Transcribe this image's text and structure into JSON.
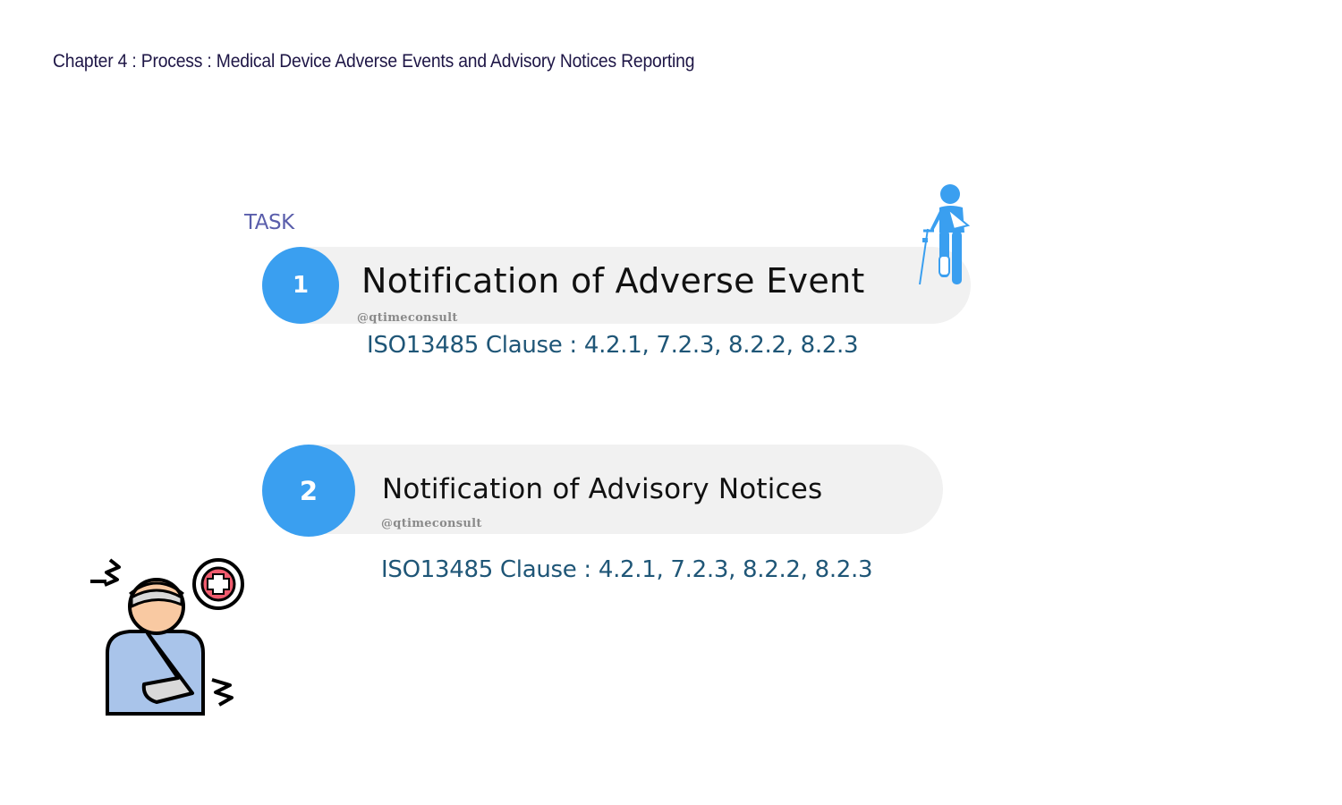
{
  "header": {
    "title": "Chapter 4 : Process : Medical Device Adverse Events and Advisory Notices Reporting"
  },
  "task_label": "TASK",
  "tasks": [
    {
      "number": "1",
      "title": "Notification of Adverse Event",
      "watermark": "@qtimeconsult",
      "clause": "ISO13485 Clause : 4.2.1, 7.2.3, 8.2.2, 8.2.3"
    },
    {
      "number": "2",
      "title": "Notification of Advisory Notices",
      "watermark": "@qtimeconsult",
      "clause": "ISO13485 Clause : 4.2.1, 7.2.3, 8.2.2, 8.2.3"
    }
  ],
  "colors": {
    "accent_blue": "#3a9ff0",
    "pill_bg": "#f1f1f1",
    "clause_text": "#1f5677",
    "task_label": "#5a5eab",
    "title_text": "#1e1646"
  },
  "icons": {
    "top_right": "person-with-crutch-icon",
    "bottom_left": "injured-patient-icon"
  }
}
